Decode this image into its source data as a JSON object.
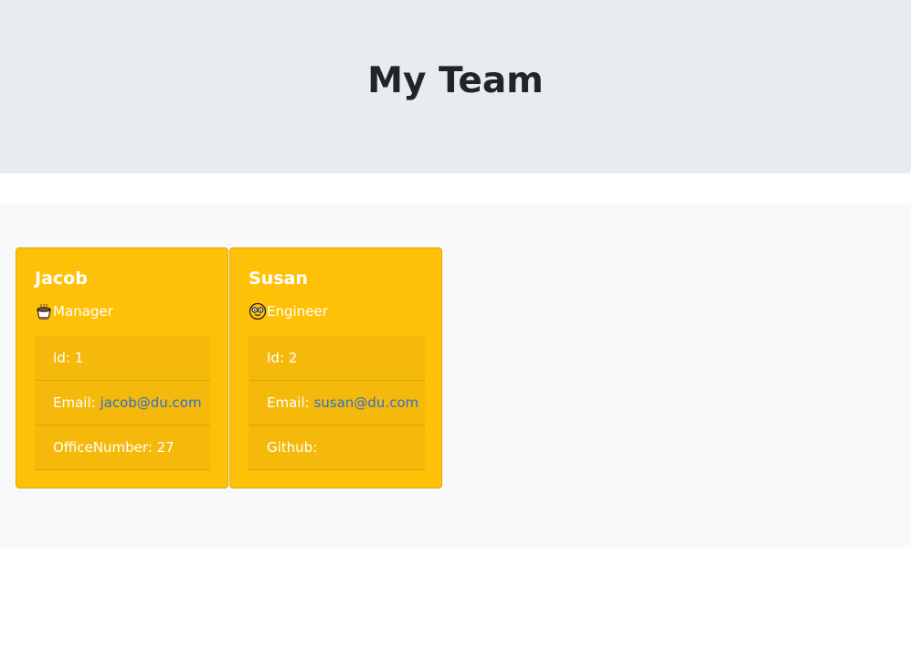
{
  "header": {
    "title": "My Team"
  },
  "team": [
    {
      "name": "Jacob",
      "role": "Manager",
      "role_icon": "coffee-cup-icon",
      "id_label": "Id: 1",
      "email_label": "Email: ",
      "email": "jacob@du.com",
      "extra_label": "OfficeNumber: 27"
    },
    {
      "name": "Susan",
      "role": "Engineer",
      "role_icon": "glasses-face-icon",
      "id_label": "Id: 2",
      "email_label": "Email: ",
      "email": "susan@du.com",
      "extra_label": "Github:"
    }
  ],
  "colors": {
    "header_background": "#e9ecef",
    "section_background": "#f8f9fa",
    "card_background": "#ffc107",
    "link": "#2f6fd0"
  }
}
